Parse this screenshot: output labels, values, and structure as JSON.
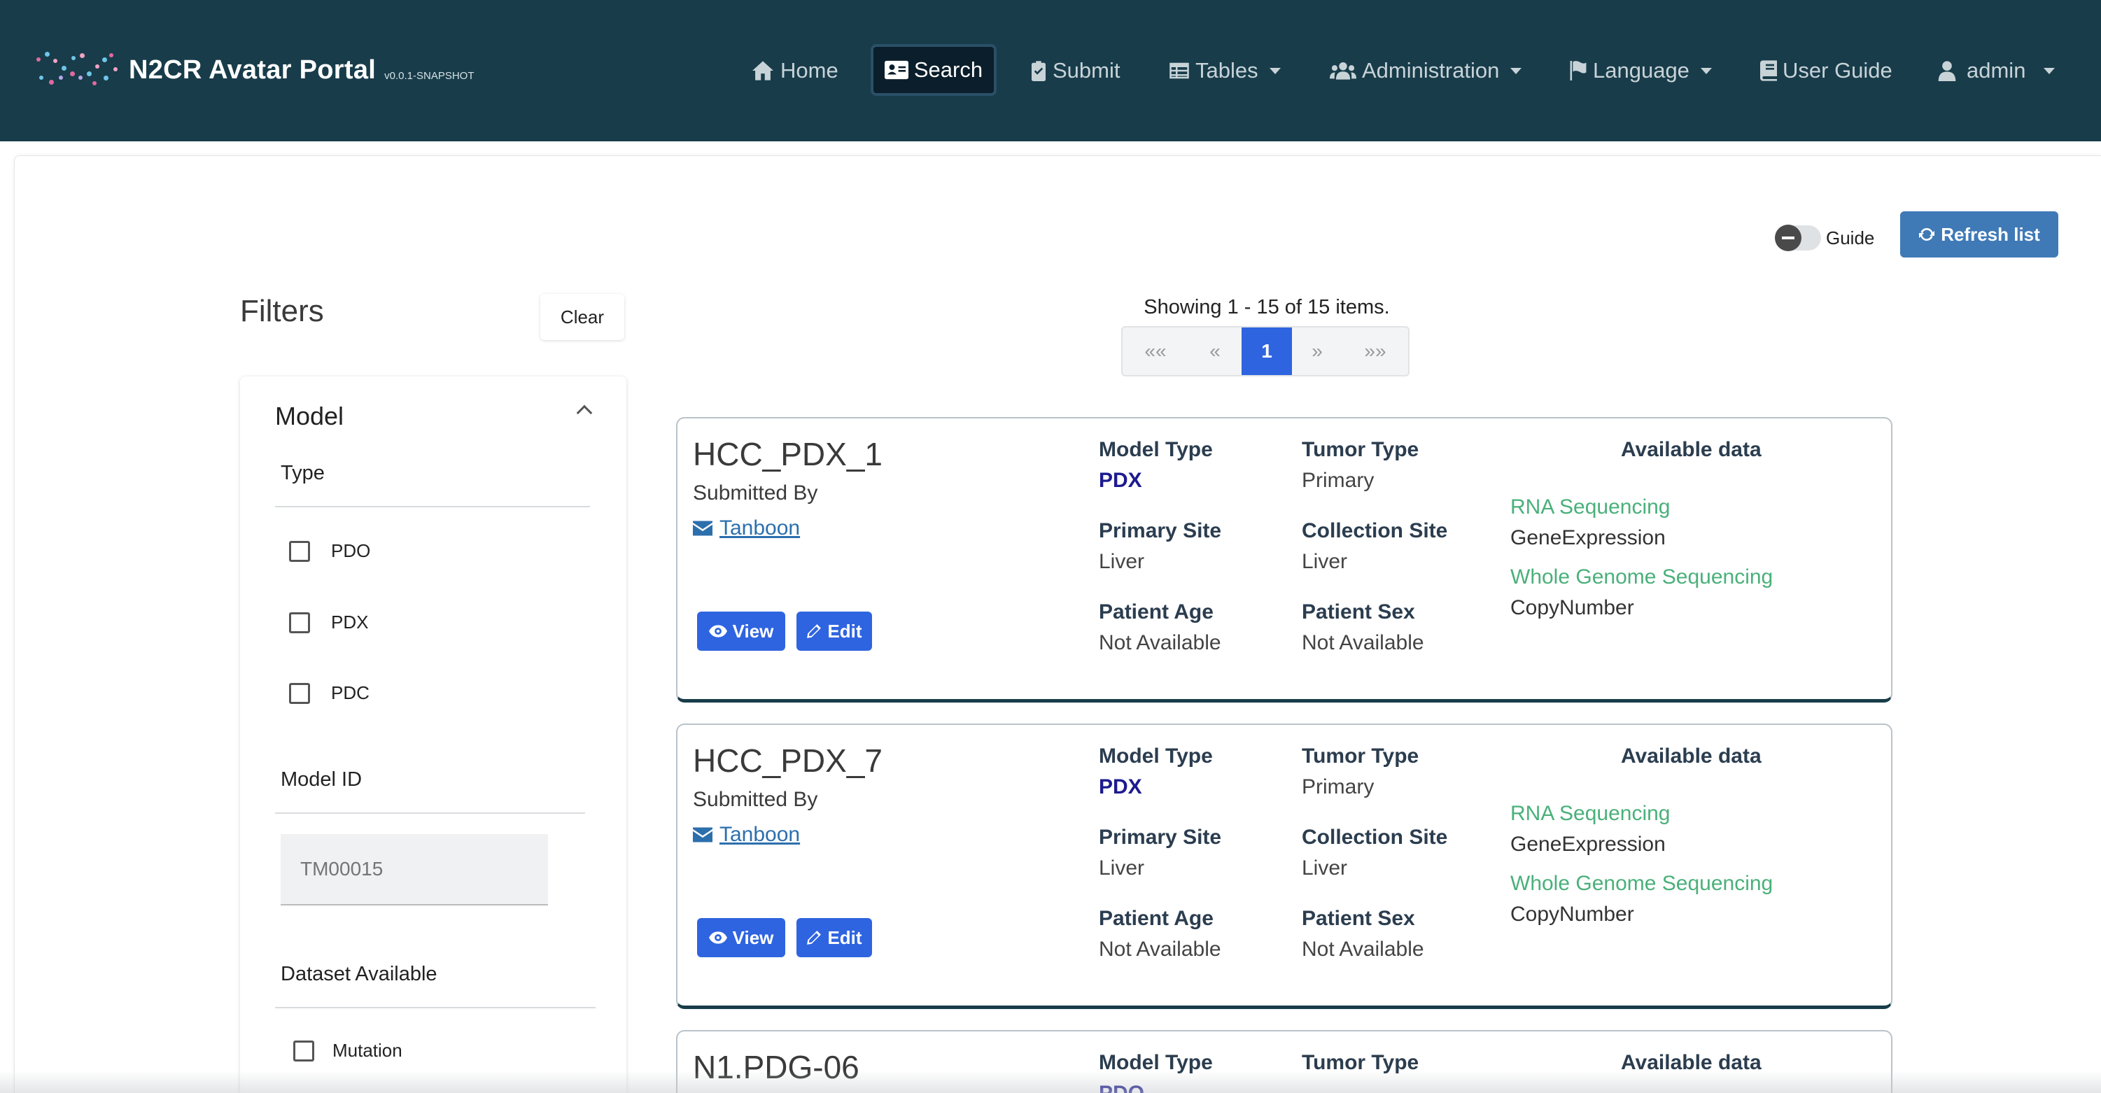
{
  "app": {
    "title": "N2CR Avatar Portal",
    "version": "v0.0.1-SNAPSHOT"
  },
  "nav": {
    "home": "Home",
    "search": "Search",
    "submit": "Submit",
    "tables": "Tables",
    "administration": "Administration",
    "language": "Language",
    "user_guide": "User Guide",
    "user": "admin"
  },
  "toolbar": {
    "guide_label": "Guide",
    "guide_on": false,
    "refresh_label": "Refresh list"
  },
  "filters": {
    "title": "Filters",
    "clear_label": "Clear",
    "section_title": "Model",
    "type_label": "Type",
    "type_options": [
      "PDO",
      "PDX",
      "PDC"
    ],
    "model_id_label": "Model ID",
    "model_id_placeholder": "TM00015",
    "dataset_label": "Dataset Available",
    "dataset_options": [
      "Mutation"
    ]
  },
  "pagination": {
    "showing": "Showing 1 - 15 of 15 items.",
    "first": "««",
    "prev": "«",
    "current": "1",
    "next": "»",
    "last": "»»"
  },
  "labels": {
    "submitted_by": "Submitted By",
    "view": "View",
    "edit": "Edit",
    "model_type": "Model Type",
    "tumor_type": "Tumor Type",
    "primary_site": "Primary Site",
    "collection_site": "Collection Site",
    "patient_age": "Patient Age",
    "patient_sex": "Patient Sex",
    "available_data": "Available data"
  },
  "models": [
    {
      "name": "HCC_PDX_1",
      "submitter": "Tanboon",
      "model_type": "PDX",
      "tumor_type": "Primary",
      "primary_site": "Liver",
      "collection_site": "Liver",
      "patient_age": "Not Available",
      "patient_sex": "Not Available",
      "datasets": [
        {
          "name": "RNA Sequencing",
          "type": "GeneExpression"
        },
        {
          "name": "Whole Genome Sequencing",
          "type": "CopyNumber"
        }
      ]
    },
    {
      "name": "HCC_PDX_7",
      "submitter": "Tanboon",
      "model_type": "PDX",
      "tumor_type": "Primary",
      "primary_site": "Liver",
      "collection_site": "Liver",
      "patient_age": "Not Available",
      "patient_sex": "Not Available",
      "datasets": [
        {
          "name": "RNA Sequencing",
          "type": "GeneExpression"
        },
        {
          "name": "Whole Genome Sequencing",
          "type": "CopyNumber"
        }
      ]
    },
    {
      "name": "N1.PDG-06",
      "model_type": "PDO"
    }
  ],
  "colors": {
    "navbar": "#183c4a",
    "primary_button": "#2f64e0",
    "refresh_button": "#3f7ab7",
    "dataset_link": "#4ab07a",
    "model_type": "#1d1b8f"
  }
}
